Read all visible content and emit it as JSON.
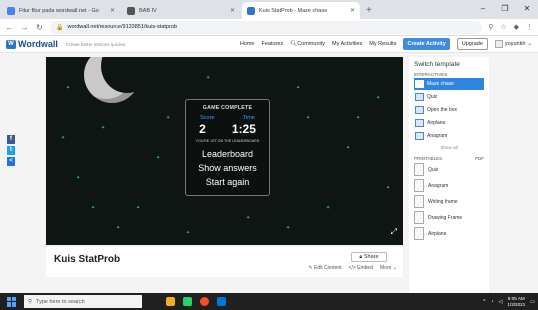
{
  "browser": {
    "tabs": [
      {
        "title": "Fitur fitur pada wordwall.net - Go",
        "color": "#4285f4",
        "active": false
      },
      {
        "title": "BAB IV",
        "color": "#555555",
        "active": false
      },
      {
        "title": "Kuis StatProb - Maze chase",
        "color": "#2e76c8",
        "active": true
      }
    ],
    "new_tab": "+",
    "url": "wordwall.net/resource/9133851/kuis-statprob"
  },
  "header": {
    "logo": "Wordwall",
    "tagline": "Create better lessons quicker",
    "nav": [
      "Home",
      "Features",
      "Community",
      "My Activities",
      "My Results"
    ],
    "create_label": "Create Activity",
    "upgrade_label": "Upgrade",
    "user_name": "yuyunkh"
  },
  "social": [
    {
      "label": "f",
      "color": "#3b5998"
    },
    {
      "label": "t",
      "color": "#1da1f2"
    },
    {
      "label": "<",
      "color": "#1a73e8"
    }
  ],
  "game": {
    "panel_title": "GAME COMPLETE",
    "score_label": "Score",
    "time_label": "Time",
    "score": "2",
    "time": "1:25",
    "leaderboard_note": "YOU'RE 1ST ON THE LEADERBOARD",
    "buttons": [
      "Leaderboard",
      "Show answers",
      "Start again"
    ]
  },
  "activity": {
    "title": "Kuis StatProb",
    "share_label": "Share",
    "links": [
      "Edit Content",
      "Embed",
      "More"
    ]
  },
  "sidebar": {
    "title": "Switch template",
    "interactives_label": "INTERACTIVES",
    "interactives": [
      {
        "label": "Maze chase",
        "selected": true
      },
      {
        "label": "Quiz",
        "selected": false
      },
      {
        "label": "Open the box",
        "selected": false
      },
      {
        "label": "Airplane",
        "selected": false
      },
      {
        "label": "Anagram",
        "selected": false
      }
    ],
    "show_all": "Show all",
    "printables_label": "PRINTABLES",
    "printables_pdf": "PDF",
    "printables": [
      "Quiz",
      "Anagram",
      "Writing frame",
      "Drawing Frame",
      "Airplane"
    ]
  },
  "taskbar": {
    "search_placeholder": "Type here to search",
    "apps": [
      "#f2b01e",
      "#25d366",
      "#f4511e",
      "#0078d7"
    ],
    "time": "8:05 AM",
    "date": "1/3/2021"
  }
}
